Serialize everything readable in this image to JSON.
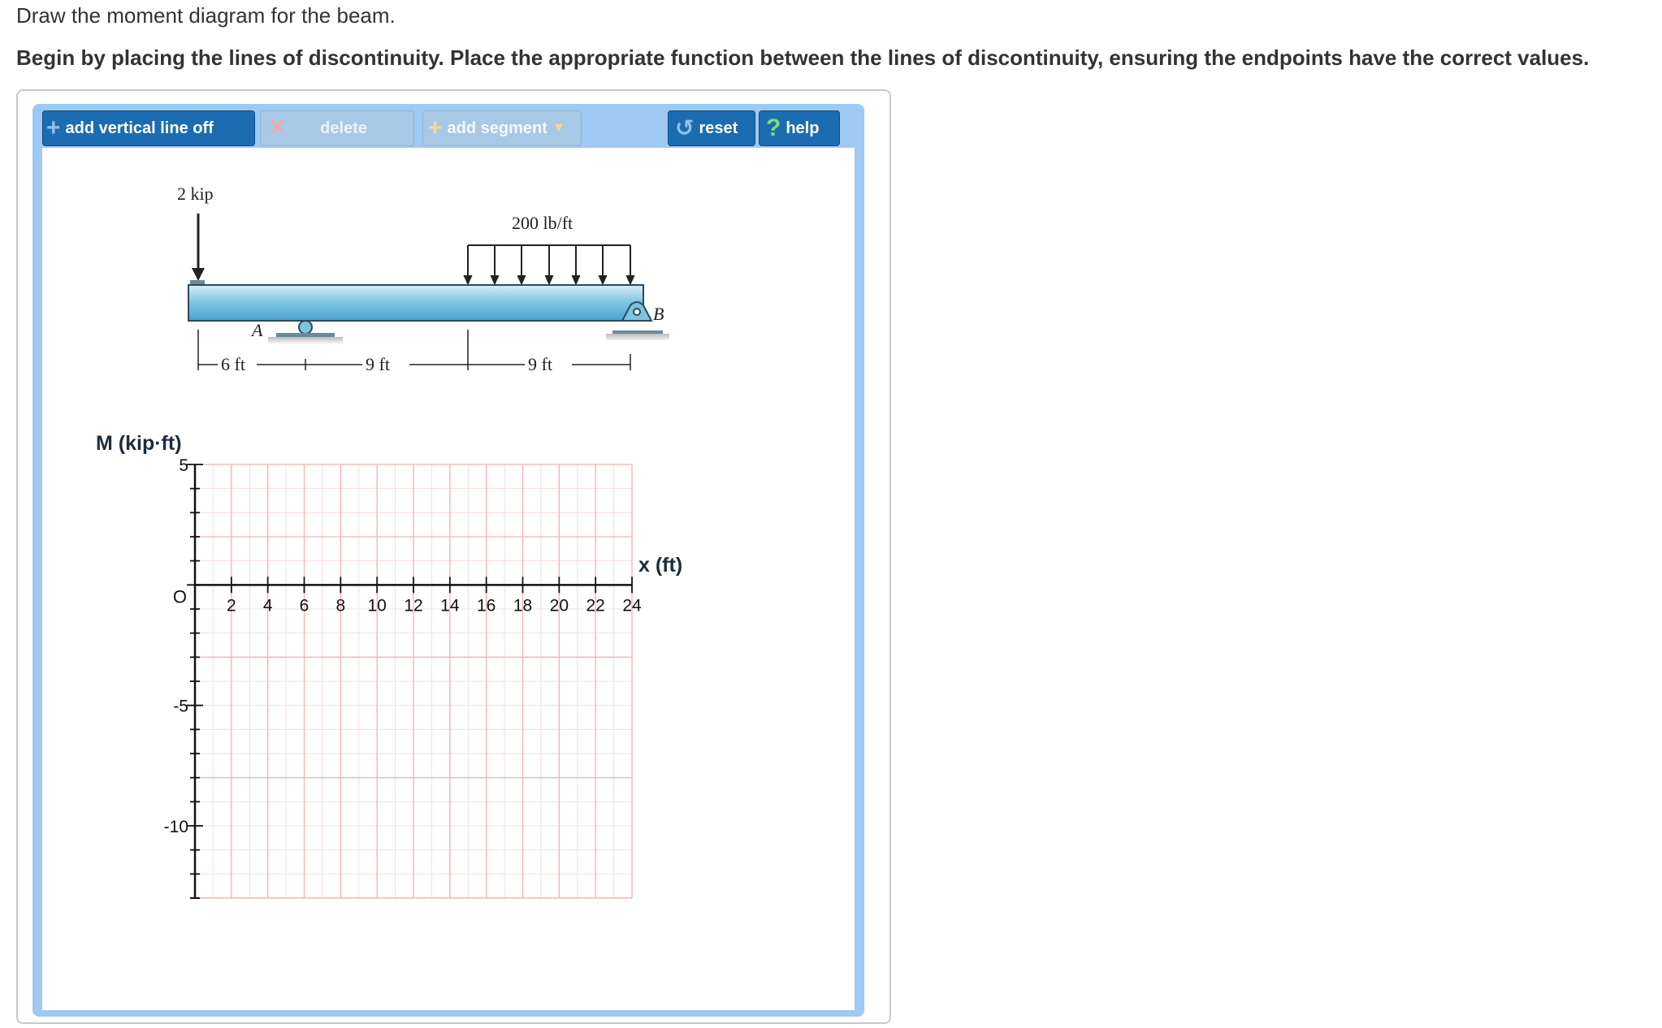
{
  "prompt": "Draw the moment diagram for the beam.",
  "instruction": "Begin by placing the lines of discontinuity. Place the appropriate function between the lines of discontinuity, ensuring the endpoints have the correct values.",
  "toolbar": {
    "add_vertical_line": "add vertical line off",
    "delete": "delete",
    "add_segment": "add segment",
    "reset": "reset",
    "help": "help"
  },
  "beam_figure": {
    "point_load": "2 kip",
    "distributed_load": "200 lb/ft",
    "support_a": "A",
    "support_b": "B",
    "dim_1": "6 ft",
    "dim_2": "9 ft",
    "dim_3": "9 ft"
  },
  "graph": {
    "y_axis_label": "M (kip·ft)",
    "x_axis_label": "x (ft)",
    "origin_label": "O",
    "x_ticks": [
      "2",
      "4",
      "6",
      "8",
      "10",
      "12",
      "14",
      "16",
      "18",
      "20",
      "22",
      "24"
    ],
    "y_ticks": [
      "5",
      "-5",
      "-10"
    ],
    "x_range": [
      0,
      24
    ],
    "y_range": [
      -13,
      5
    ],
    "grid_color": "#f2b3b3"
  }
}
